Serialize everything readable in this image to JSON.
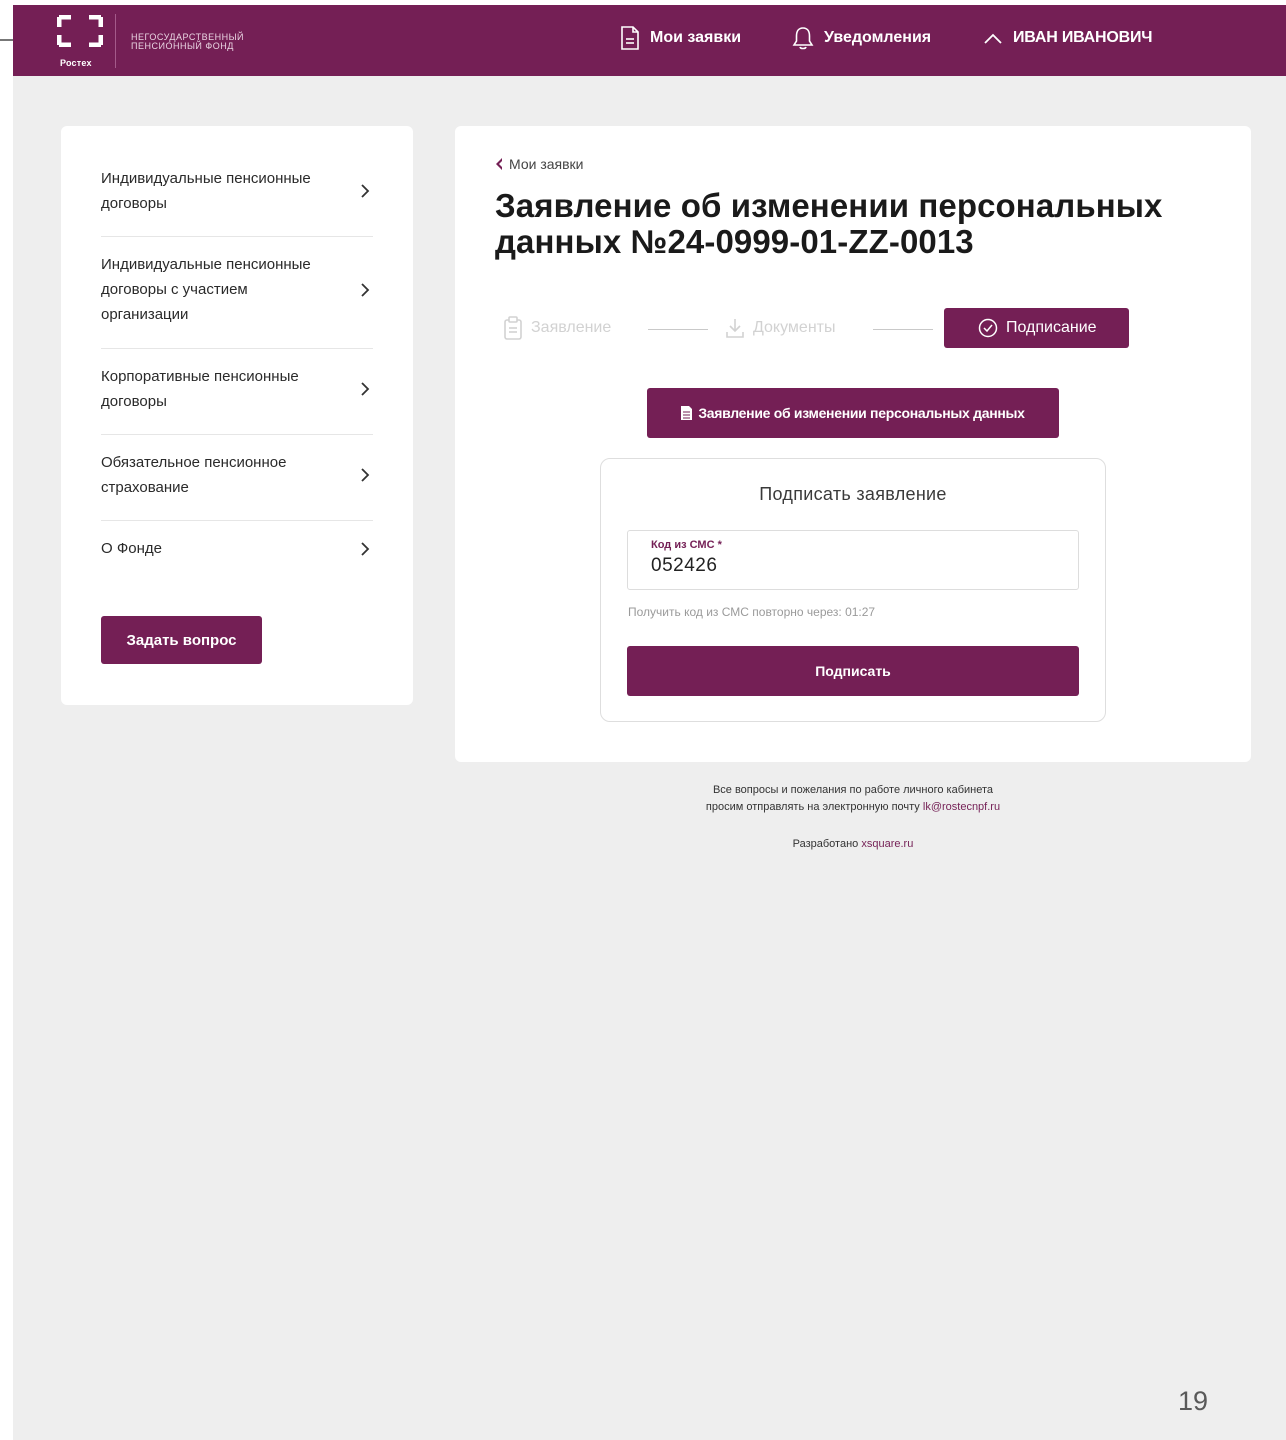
{
  "brand": {
    "logo_text": "Ростех",
    "fund_name_line1": "Негосударственный",
    "fund_name_line2": "пенсионный фонд"
  },
  "header": {
    "applications_label": "Мои заявки",
    "notifications_label": "Уведомления",
    "user_label": "ИВАН ИВАНОВИЧ"
  },
  "sidebar": {
    "items": [
      {
        "label": "Индивидуальные пенсионные договоры"
      },
      {
        "label": "Индивидуальные пенсионные договоры с участием организации"
      },
      {
        "label": "Корпоративные пенсионные договоры"
      },
      {
        "label": "Обязательное пенсионное страхование"
      },
      {
        "label": "О Фонде"
      }
    ],
    "ask_button": "Задать вопрос"
  },
  "main": {
    "back_link": "Мои заявки",
    "title": "Заявление об изменении персональных данных №24-0999-01-ZZ-0013",
    "steps": [
      {
        "label": "Заявление",
        "state": "done"
      },
      {
        "label": "Документы",
        "state": "done"
      },
      {
        "label": "Подписание",
        "state": "active"
      }
    ],
    "document_button": "Заявление об изменении персональных данных",
    "sign": {
      "title": "Подписать заявление",
      "sms_label": "Код из СМС *",
      "sms_value": "052426",
      "resend_text": "Получить код из СМС повторно через: 01:27",
      "sign_button": "Подписать"
    }
  },
  "footer": {
    "line1": "Все вопросы и пожелания по работе личного кабинета",
    "line2_prefix": "просим отправлять на электронную почту",
    "email": "lk@rostecnpf.ru",
    "dev_prefix": "Разработано",
    "dev_link": "xsquare.ru"
  },
  "slide": {
    "page_number": "19"
  },
  "colors": {
    "brand": "#741f55",
    "background": "#eeeeee",
    "card": "#ffffff"
  }
}
